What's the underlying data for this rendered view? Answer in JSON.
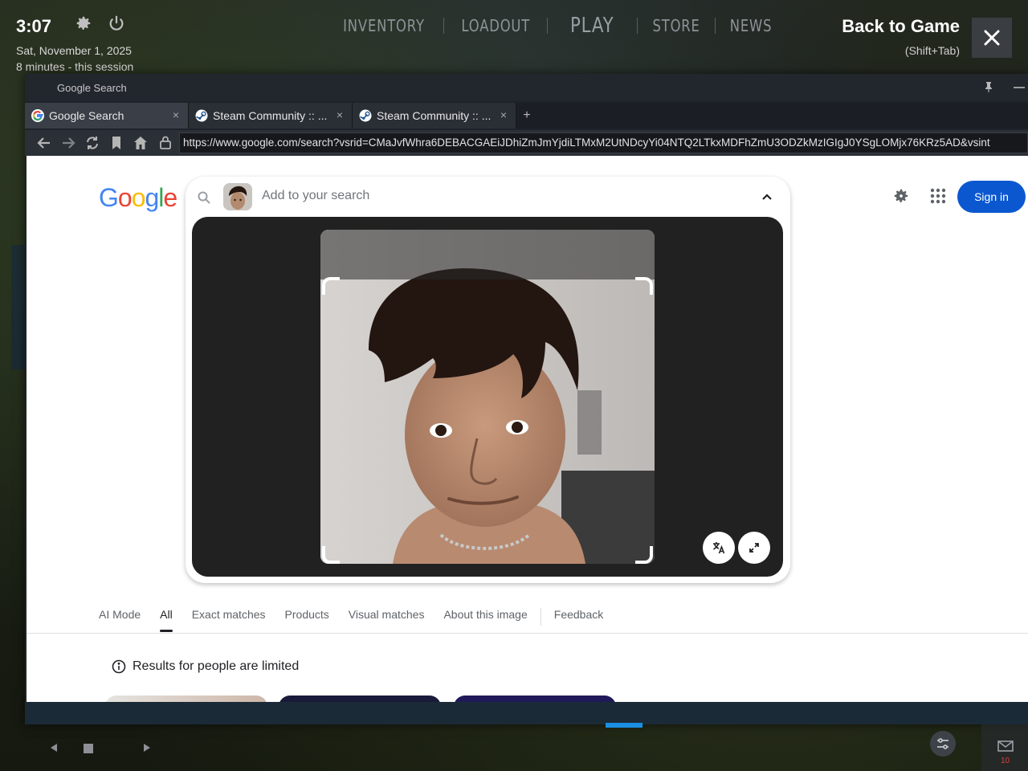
{
  "overlay": {
    "clock": "3:07",
    "date": "Sat, November 1, 2025",
    "session": "8 minutes - this session",
    "back_to_game": "Back to Game",
    "back_shortcut": "(Shift+Tab)",
    "game_nav": [
      "INVENTORY",
      "LOADOUT",
      "PLAY",
      "STORE",
      "NEWS"
    ]
  },
  "browser": {
    "window_title": "Google Search",
    "tabs": [
      {
        "label": "Google Search",
        "icon": "google-icon",
        "active": true
      },
      {
        "label": "Steam Community :: ...",
        "icon": "steam-icon",
        "active": false
      },
      {
        "label": "Steam Community :: ...",
        "icon": "steam-icon",
        "active": false
      }
    ],
    "url": "https://www.google.com/search?vsrid=CMaJvfWhra6DEBACGAEiJDhiZmJmYjdiLTMxM2UtNDcyYi04NTQ2LTkxMDFhZmU3ODZkMzIGIgJ0YSgLOMjx76KRz5AD&vsint"
  },
  "google": {
    "logo": "Google",
    "search_placeholder": "Add to your search",
    "sign_in": "Sign in",
    "result_tabs": [
      "AI Mode",
      "All",
      "Exact matches",
      "Products",
      "Visual matches",
      "About this image",
      "Feedback"
    ],
    "active_tab": "All",
    "limited_note": "Results for people are limited"
  },
  "hud": {
    "mail_count": "10"
  },
  "colors": {
    "accent": "#0b57d0",
    "overlay_bg": "#1e2229",
    "hud_progress": "#1a8fe3"
  }
}
